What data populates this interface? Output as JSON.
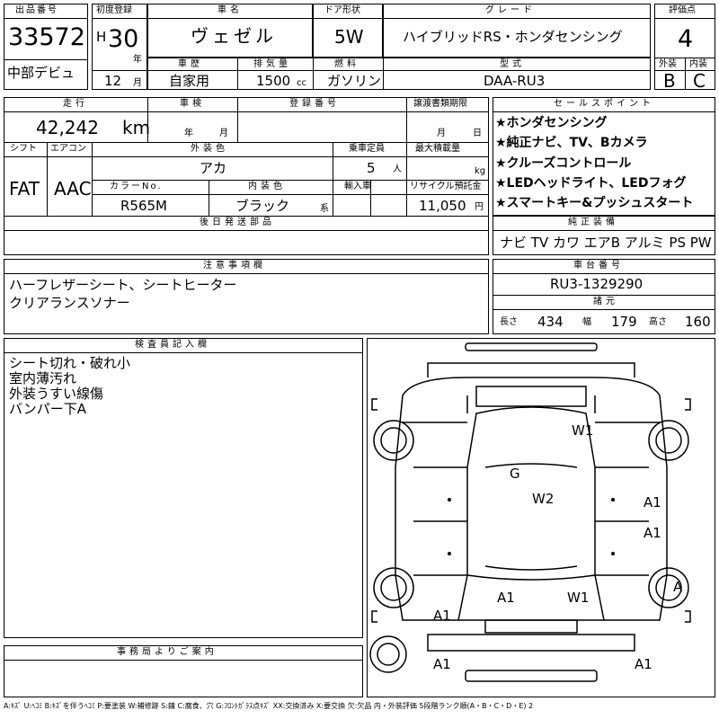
{
  "header": {
    "lot_label": "出品番号",
    "lot_value": "33572",
    "debut": "中部デビュ",
    "first_reg_label": "初度登録",
    "era": "H",
    "year": "30",
    "year_unit": "年",
    "month": "12",
    "month_unit": "月",
    "car_name_label": "車名",
    "car_name": "ヴェゼル",
    "door_label": "ドア形状",
    "door_value": "5W",
    "grade_label": "グレード",
    "grade_value": "ハイブリッドRS・ホンダセンシング",
    "score_label": "評価点",
    "score_value": "4",
    "history_label": "車歴",
    "history_value": "自家用",
    "displacement_label": "排気量",
    "displacement_value": "1500",
    "displacement_unit": "cc",
    "fuel_label": "燃料",
    "fuel_value": "ガソリン",
    "model_label": "型式",
    "model_value": "DAA-RU3",
    "exterior_label": "外装",
    "exterior_value": "B",
    "interior_label": "内装",
    "interior_value": "C"
  },
  "row2": {
    "mileage_label": "走行",
    "mileage_value": "42,242",
    "mileage_unit": "km",
    "inspection_label": "車検",
    "insp_year_unit": "年",
    "insp_month_unit": "月",
    "reg_label": "登録番号",
    "transfer_label": "譲渡書類期限",
    "transfer_month_unit": "月",
    "transfer_day_unit": "日",
    "shift_label": "シフト",
    "shift_value": "FAT",
    "ac_label": "エアコン",
    "ac_value": "AAC",
    "ext_color_label": "外装色",
    "ext_color_value": "アカ",
    "capacity_label": "乗車定員",
    "capacity_value": "5",
    "capacity_unit": "人",
    "load_label": "最大積載量",
    "load_unit": "kg",
    "color_no_label": "カラーNo.",
    "color_no_value": "R565M",
    "int_color_label": "内装色",
    "int_color_value": "ブラック",
    "int_color_suffix": "系",
    "import_label": "輸入車",
    "recycle_label": "リサイクル預託金",
    "recycle_value": "11,050",
    "recycle_unit": "円",
    "later_parts_label": "後日発送部品"
  },
  "sales_points": {
    "label": "セールスポイント",
    "items": [
      "★ホンダセンシング",
      "★純正ナビ、TV、Bカメラ",
      "★クルーズコントロール",
      "★LEDヘッドライト、LEDフォグ",
      "★スマートキー&プッシュスタート"
    ]
  },
  "equipment": {
    "label": "純正装備",
    "value": "ナビ TV カワ エアB アルミ PS PW"
  },
  "notes": {
    "label": "注意事項欄",
    "lines": [
      "ハーフレザーシート、シートヒーター",
      "クリアランスソナー"
    ]
  },
  "chassis": {
    "label": "車台番号",
    "value": "RU3-1329290"
  },
  "dims": {
    "label": "諸元",
    "length_label": "長さ",
    "length": "434",
    "width_label": "幅",
    "width": "179",
    "height_label": "高さ",
    "height": "160"
  },
  "inspector": {
    "label": "検査員記入欄",
    "lines": [
      "シート切れ・破れ小",
      "室内薄汚れ",
      "外装うすい線傷",
      "バンパー下A"
    ]
  },
  "office": {
    "label": "事務局よりご案内"
  },
  "diagram": {
    "marks": [
      "W1",
      "G",
      "W2",
      "A1",
      "A1",
      "A",
      "A1",
      "W1",
      "A1",
      "A1",
      "A1"
    ]
  },
  "legend": "A:ｷｽﾞ U:ﾍｺﾐ B:ｷｽﾞを伴うﾍｺﾐ P:要塗装 W:補修跡 S:錆 C:腐食、穴 G:ﾌﾛﾝﾄｶﾞﾗｽ点ｷｽﾞ XX:交換済み X:要交換 欠:欠品 内・外装評価 5段階ランク順(A・B・C・D・E) 2"
}
